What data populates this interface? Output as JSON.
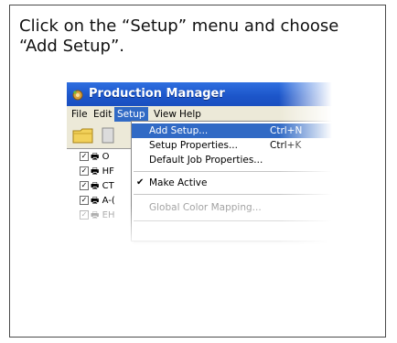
{
  "instruction": "Click on the “Setup” menu and choose “Add Setup”.",
  "window": {
    "title": "Production Manager",
    "title_color": "#1c55c9"
  },
  "menubar": {
    "items": [
      "File",
      "Edit",
      "Setup",
      "View",
      "Help"
    ],
    "active": "Setup",
    "highlight_color": "#316ac5"
  },
  "setup_menu": {
    "items": [
      {
        "label": "Add Setup...",
        "shortcut": "Ctrl+N",
        "highlighted": true
      },
      {
        "label": "Setup Properties...",
        "shortcut": "Ctrl+K"
      },
      {
        "label": "Default Job Properties..."
      },
      {
        "label": "Make Active",
        "checked": true
      },
      {
        "label": "Global Color Mapping...",
        "disabled": true
      }
    ]
  },
  "tree": {
    "items": [
      "O",
      "HF",
      "CT",
      "A-(",
      "EH"
    ]
  }
}
